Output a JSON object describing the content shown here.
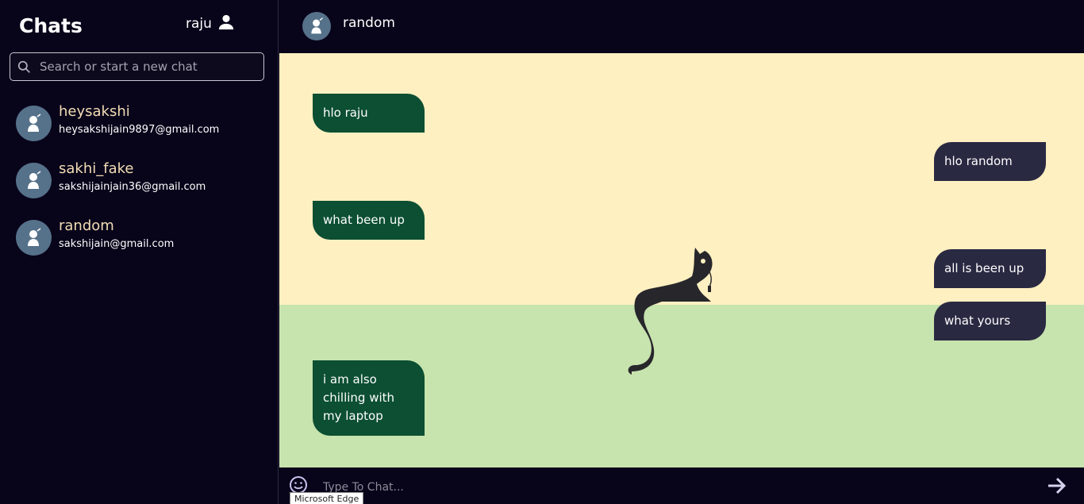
{
  "sidebar": {
    "title": "Chats",
    "user_name": "raju",
    "search_placeholder": "Search or start a new chat",
    "contacts": [
      {
        "name": "heysakshi",
        "email": "heysakshijain9897@gmail.com"
      },
      {
        "name": "sakhi_fake",
        "email": "sakshijainjain36@gmail.com"
      },
      {
        "name": "random",
        "email": "sakshijain@gmail.com"
      }
    ]
  },
  "header": {
    "name": "random"
  },
  "messages": [
    {
      "text": "hlo raju",
      "direction": "incoming"
    },
    {
      "text": "hlo random",
      "direction": "outgoing"
    },
    {
      "text": "what been up",
      "direction": "incoming"
    },
    {
      "text": "all is been up",
      "direction": "outgoing"
    },
    {
      "text": "what yours",
      "direction": "outgoing"
    },
    {
      "text": "i am also chilling with my laptop",
      "direction": "incoming"
    }
  ],
  "composer": {
    "placeholder": "Type To Chat..."
  },
  "tooltip": "Microsoft Edge",
  "colors": {
    "sidebar_bg": "#08041a",
    "contact_name": "#f3ddb5",
    "incoming_bubble": "#0c4f33",
    "outgoing_bubble": "#2a2942",
    "wall": "#fff0c1",
    "floor": "#c7e3ae",
    "avatar_bg": "#56718a"
  },
  "icons": {
    "user": "person-icon",
    "search": "search-icon",
    "avatar": "default-avatar-icon",
    "emoji": "smiley-icon",
    "send": "arrow-right-icon"
  }
}
